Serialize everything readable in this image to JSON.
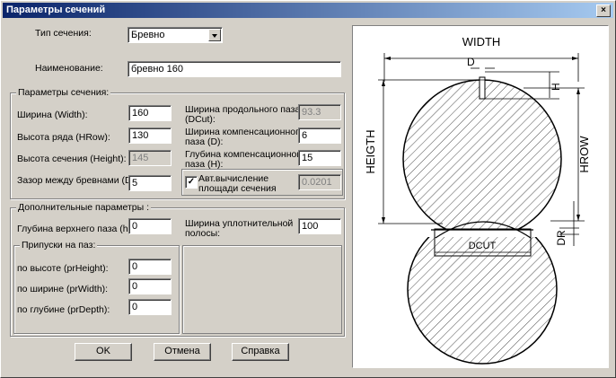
{
  "window": {
    "title": "Параметры сечений",
    "close": "×"
  },
  "type": {
    "label": "Тип сечения:",
    "value": "Бревно"
  },
  "name": {
    "label": "Наименование:",
    "value": "бревно 160"
  },
  "params": {
    "title": "Параметры сечения:",
    "width": {
      "label": "Ширина (Width):",
      "value": "160"
    },
    "hrow": {
      "label": "Высота ряда (HRow):",
      "value": "130"
    },
    "height": {
      "label": "Высота сечения (Height):",
      "value": "145"
    },
    "dr": {
      "label": "Зазор между бревнами (DR):",
      "value": "5"
    },
    "dcut": {
      "label1": "Ширина продольного паза",
      "label2": "(DCut):",
      "value": "93.3"
    },
    "d": {
      "label1": "Ширина компенсационного",
      "label2": "паза (D):",
      "value": "6"
    },
    "h": {
      "label1": "Глубина компенсационного",
      "label2": "паза (H):",
      "value": "15"
    },
    "auto": {
      "label1": "Авт.вычисление",
      "label2": "площади сечения",
      "value": "0.0201",
      "check": "✓"
    }
  },
  "extra": {
    "title": "Дополнительные параметры :",
    "hup": {
      "label": "Глубина верхнего паза (hUp):",
      "value": "0"
    },
    "seal": {
      "label1": "Ширина уплотнительной",
      "label2": "полосы:",
      "value": "100"
    }
  },
  "allow": {
    "title": "Припуски на паз:",
    "prheight": {
      "label": "по высоте (prHeight):",
      "value": "0"
    },
    "prwidth": {
      "label": "по ширине (prWidth):",
      "value": "0"
    },
    "prdepth": {
      "label": "по глубине (prDepth):",
      "value": "0"
    }
  },
  "buttons": {
    "ok": "OK",
    "cancel": "Отмена",
    "help": "Справка"
  },
  "drawing": {
    "width": "WIDTH",
    "d": "D",
    "h": "H",
    "heigth": "HEIGTH",
    "hrow": "HROW",
    "dr": "DR",
    "dcut": "DCUT"
  }
}
